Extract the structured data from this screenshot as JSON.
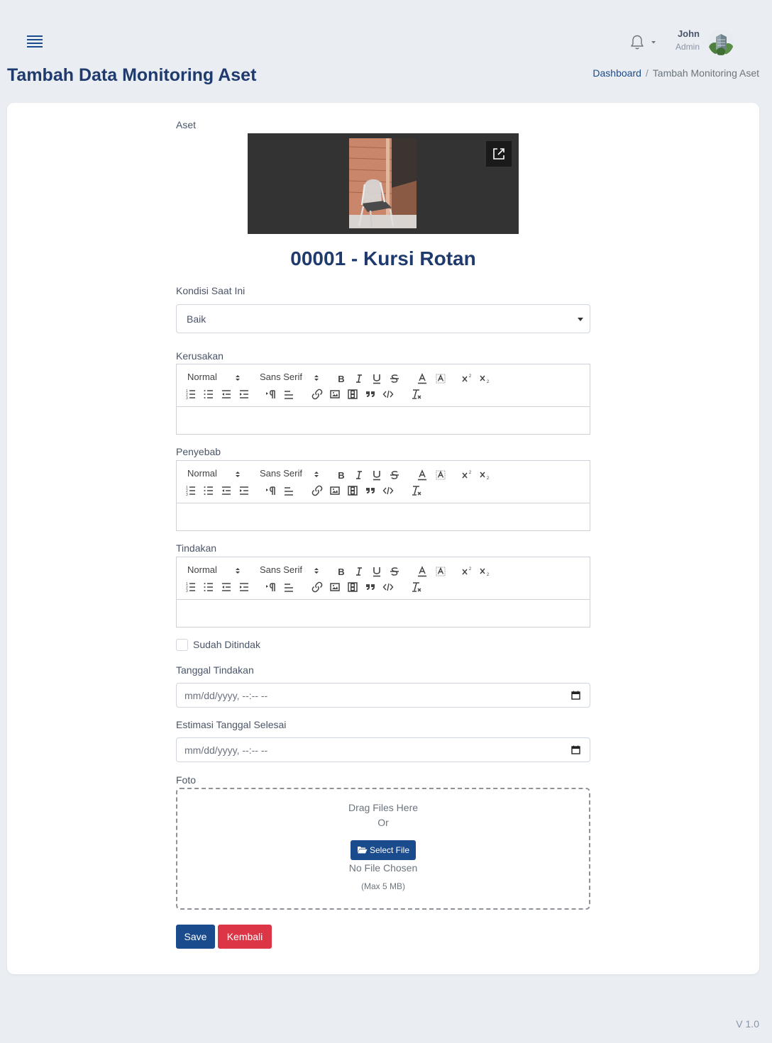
{
  "header": {
    "user_name": "John",
    "user_role": "Admin",
    "icons": {
      "menu": "hamburger-icon",
      "notifications": "bell-icon",
      "dropdown": "caret-down-icon"
    }
  },
  "page": {
    "title": "Tambah Data Monitoring Aset",
    "breadcrumb": {
      "home": "Dashboard",
      "separator": "/",
      "current": "Tambah Monitoring Aset"
    }
  },
  "form": {
    "asset_label": "Aset",
    "asset_name": "00001 - Kursi Rotan",
    "condition_label": "Kondisi Saat Ini",
    "condition_value": "Baik",
    "editors": [
      {
        "label": "Kerusakan"
      },
      {
        "label": "Penyebab"
      },
      {
        "label": "Tindakan"
      }
    ],
    "editor_toolbar": {
      "header_picker": "Normal",
      "font_picker": "Sans Serif"
    },
    "checkbox_label": "Sudah Ditindak",
    "checkbox_checked": false,
    "tanggal_label": "Tanggal Tindakan",
    "tanggal_placeholder": "mm/dd/yyyy, --:-- --",
    "estimasi_label": "Estimasi Tanggal Selesai",
    "estimasi_placeholder": "mm/dd/yyyy, --:-- --",
    "foto_label": "Foto",
    "dropzone": {
      "line1": "Drag Files Here",
      "line2": "Or",
      "button": "Select File",
      "status": "No File Chosen",
      "hint": "(Max 5 MB)"
    },
    "save_button": "Save",
    "back_button": "Kembali"
  },
  "footer": {
    "version": "V 1.0"
  },
  "colors": {
    "primary": "#1a4b8c",
    "danger": "#dc3545",
    "title": "#1f3b6e",
    "background": "#eaedf2"
  }
}
